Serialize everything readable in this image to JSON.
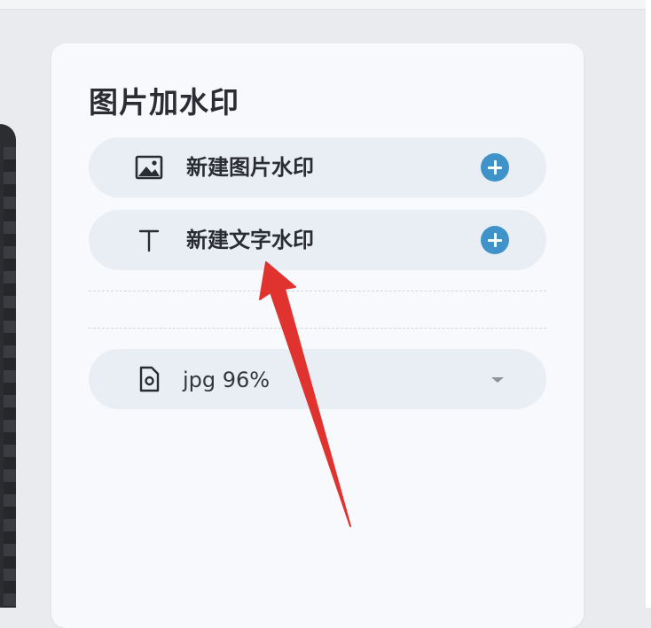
{
  "panel": {
    "title": "图片加水印"
  },
  "rows": [
    {
      "label": "新建图片水印",
      "icon": "image-icon",
      "action_icon": "plus-circle-icon"
    },
    {
      "label": "新建文字水印",
      "icon": "text-icon",
      "action_icon": "plus-circle-icon"
    }
  ],
  "output_format": {
    "value": "jpg 96%",
    "icon": "file-settings-icon",
    "dropdown_icon": "chevron-down-icon"
  },
  "colors": {
    "accent": "#3f93c9",
    "annotation_arrow": "#e0332f",
    "panel_background": "#f7f9fc",
    "row_background": "#e9eef5"
  }
}
